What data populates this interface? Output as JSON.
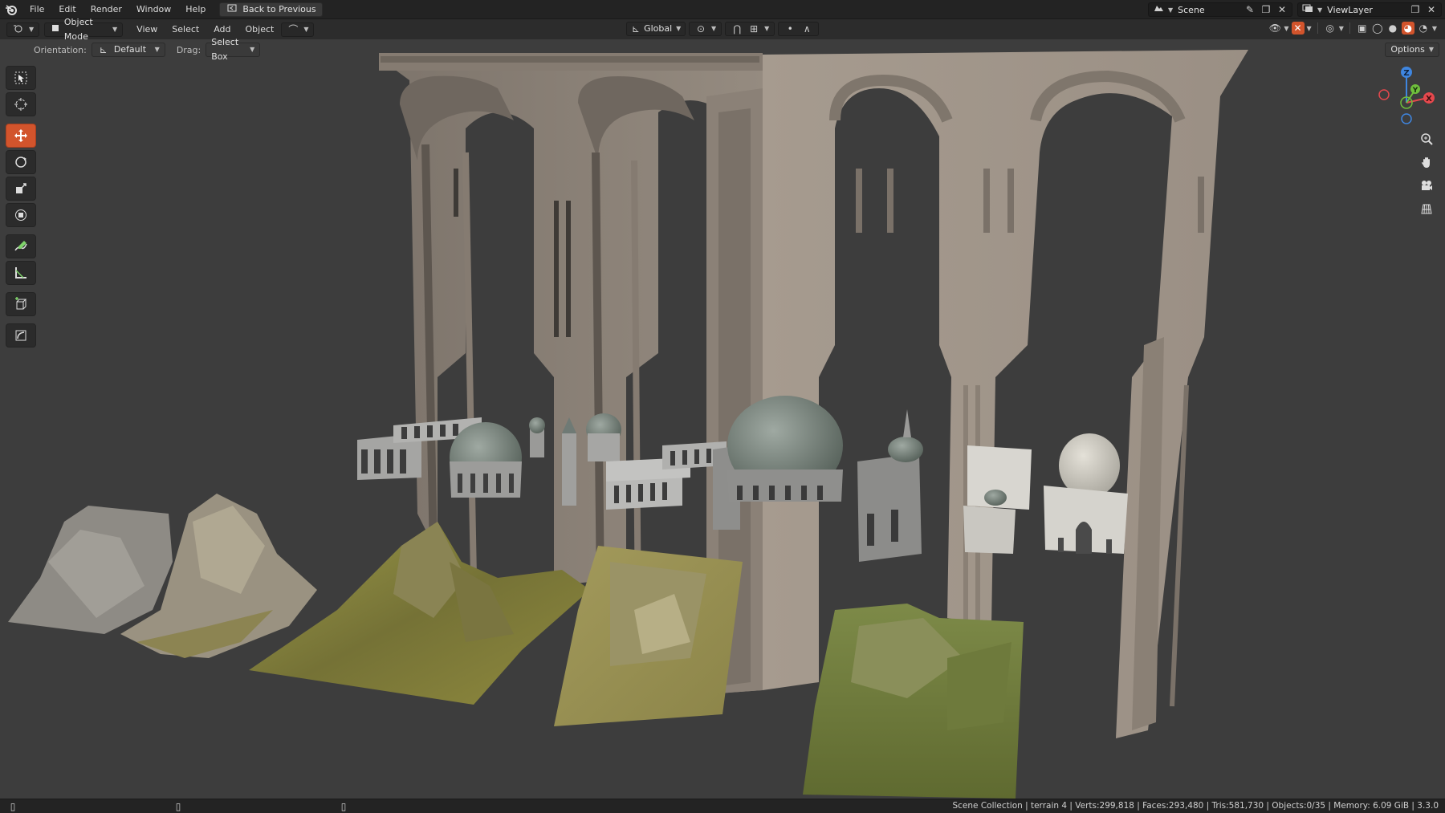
{
  "topbar": {
    "menus": [
      "File",
      "Edit",
      "Render",
      "Window",
      "Help"
    ],
    "back_button": "Back to Previous",
    "scene": "Scene",
    "view_layer": "ViewLayer"
  },
  "header": {
    "mode": "Object Mode",
    "menus": [
      "View",
      "Select",
      "Add",
      "Object"
    ],
    "transform_orientation": "Global"
  },
  "tool_options": {
    "orientation_label": "Orientation:",
    "orientation_value": "Default",
    "drag_label": "Drag:",
    "drag_value": "Select Box",
    "options_button": "Options"
  },
  "gizmo": {
    "z": "Z",
    "y": "Y",
    "x": "X"
  },
  "status": {
    "text": "Scene Collection | terrain 4 | Verts:299,818 | Faces:293,480 | Tris:581,730 | Objects:0/35 | Memory: 6.09 GiB | 3.3.0"
  },
  "colors": {
    "accent_active_tool": "#d2542c",
    "axis_x": "#e5484d",
    "axis_y": "#6fbf3c",
    "axis_z": "#3f86e0",
    "viewport_bg": "#3d3d3d"
  }
}
